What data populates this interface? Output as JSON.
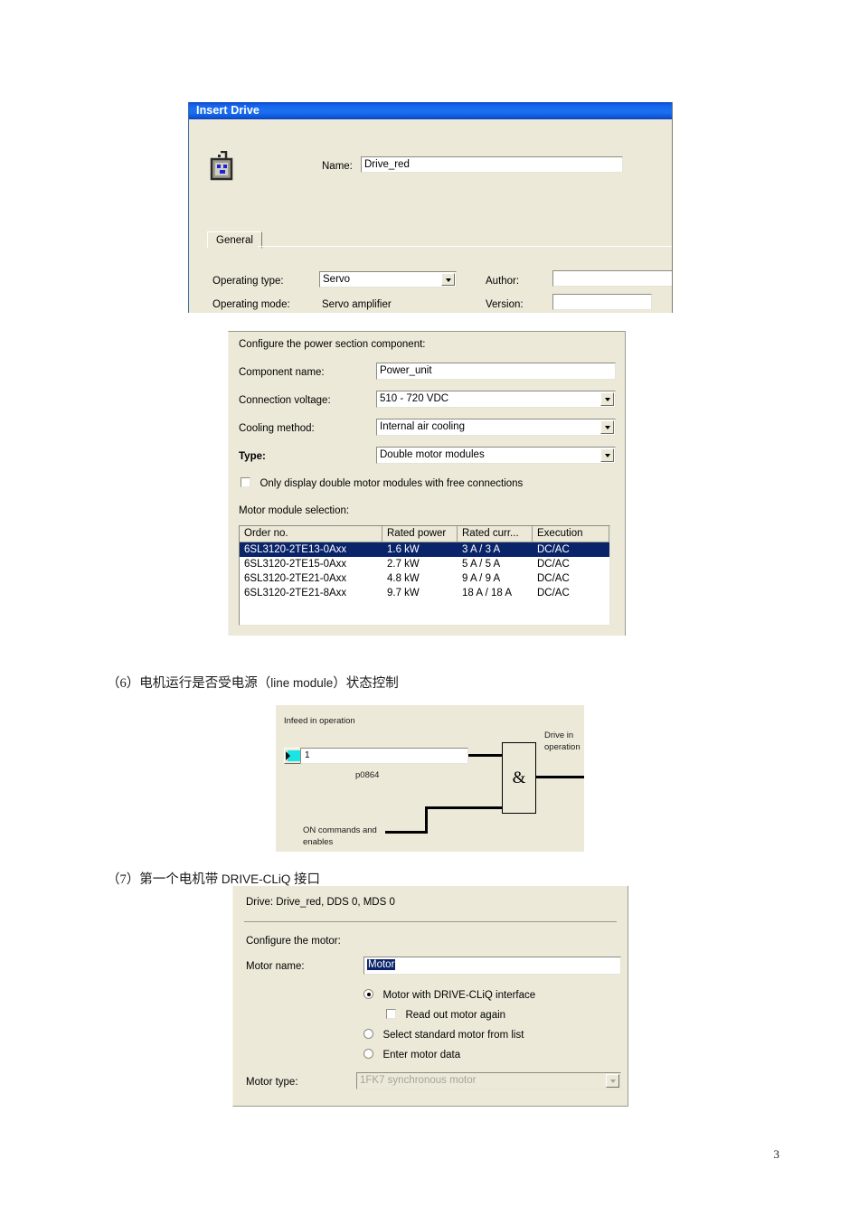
{
  "page": {
    "number": "3"
  },
  "document_lines": [
    {
      "prefix": "（6）",
      "text": "电机运行是否受电源（",
      "latin": "line module",
      "text2": "）状态控制"
    },
    {
      "prefix": "（7）",
      "text": "第一个电机带 ",
      "latin": "DRIVE-CLiQ",
      "text2": " 接口"
    }
  ],
  "insert_drive_dialog": {
    "title": "Insert Drive",
    "icon": "drive-module-icon",
    "name_label": "Name:",
    "name_value": "Drive_red",
    "tab_general": "General",
    "operating_type_label": "Operating type:",
    "operating_type_value": "Servo",
    "operating_mode_label": "Operating mode:",
    "operating_mode_value": "Servo amplifier",
    "author_label": "Author:",
    "author_value": "",
    "version_label": "Version:",
    "version_value": ""
  },
  "power_section_dialog": {
    "heading": "Configure the power section component:",
    "component_name_label": "Component name:",
    "component_name_value": "Power_unit",
    "connection_voltage_label": "Connection voltage:",
    "connection_voltage_value": "510 - 720 VDC",
    "cooling_method_label": "Cooling method:",
    "cooling_method_value": "Internal air cooling",
    "type_label": "Type:",
    "type_value": "Double motor modules",
    "checkbox_label": "Only display double motor modules with free connections",
    "checkbox_checked": false,
    "list_label": "Motor module selection:",
    "columns": [
      "Order no.",
      "Rated power",
      "Rated curr...",
      "Execution"
    ],
    "rows": [
      {
        "order_no": "6SL3120-2TE13-0Axx",
        "rated_power": "1.6 kW",
        "rated_current": "3 A / 3 A",
        "execution": "DC/AC",
        "selected": true
      },
      {
        "order_no": "6SL3120-2TE15-0Axx",
        "rated_power": "2.7 kW",
        "rated_current": "5 A / 5 A",
        "execution": "DC/AC",
        "selected": false
      },
      {
        "order_no": "6SL3120-2TE21-0Axx",
        "rated_power": "4.8 kW",
        "rated_current": "9 A / 9 A",
        "execution": "DC/AC",
        "selected": false
      },
      {
        "order_no": "6SL3120-2TE21-8Axx",
        "rated_power": "9.7 kW",
        "rated_current": "18 A / 18 A",
        "execution": "DC/AC",
        "selected": false
      }
    ]
  },
  "logic_diagram": {
    "infeed_label": "Infeed in operation",
    "input_value": "1",
    "parameter": "p0864",
    "on_commands_line1": "ON commands and",
    "on_commands_line2": "enables",
    "gate_symbol": "&",
    "output_line1": "Drive in",
    "output_line2": "operation"
  },
  "motor_dialog": {
    "header": "Drive: Drive_red, DDS 0, MDS 0",
    "heading": "Configure the motor:",
    "motor_name_label": "Motor name:",
    "motor_name_value": "Motor",
    "option_drive_cliq": "Motor with DRIVE-CLiQ interface",
    "option_drive_cliq_selected": true,
    "checkbox_read_out": "Read out motor again",
    "checkbox_read_out_checked": false,
    "option_standard_list": "Select standard motor from list",
    "option_standard_list_selected": false,
    "option_enter_data": "Enter motor data",
    "option_enter_data_selected": false,
    "motor_type_label": "Motor type:",
    "motor_type_value": "1FK7 synchronous motor"
  },
  "colors": {
    "title_bar_blue": "#1a6ef0",
    "dialog_face": "#ece9d8",
    "selection_blue": "#0a246a",
    "button_cyan": "#19e5e5"
  }
}
